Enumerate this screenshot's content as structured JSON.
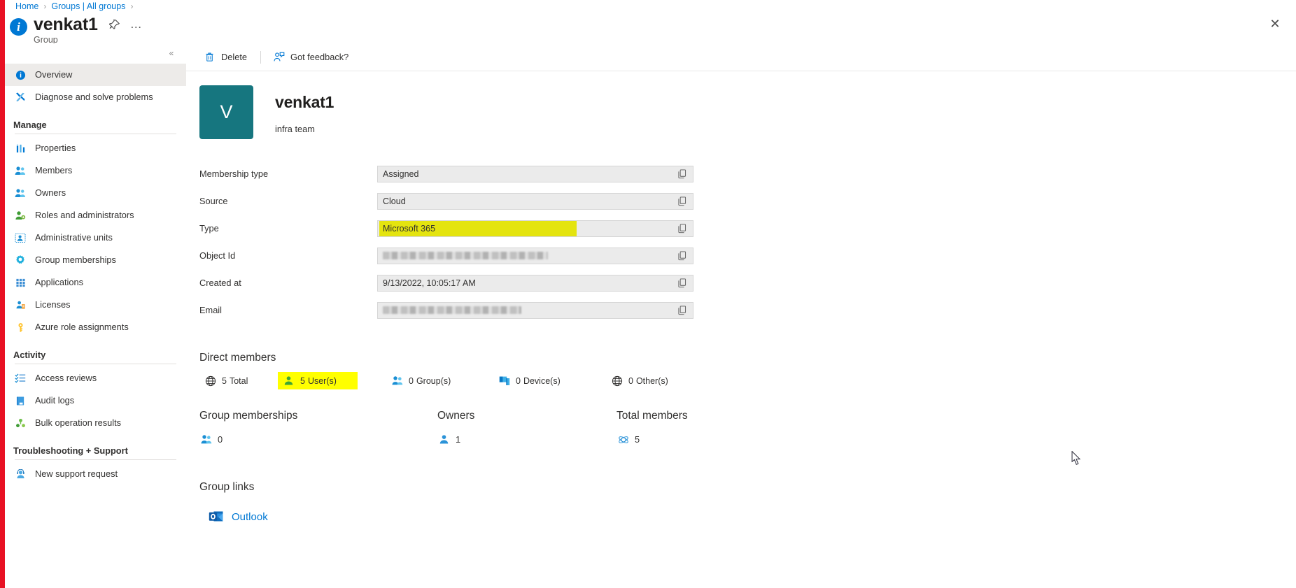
{
  "breadcrumb": {
    "items": [
      "Home",
      "Groups | All groups"
    ],
    "separator": "›"
  },
  "blade": {
    "title": "venkat1",
    "subtitle": "Group",
    "pin_label": "Pin to dashboard",
    "more_label": "…",
    "close_label": "✕",
    "collapse_label": "«"
  },
  "sidebar": {
    "items": [
      {
        "label": "Overview",
        "icon": "info-icon",
        "selected": true
      },
      {
        "label": "Diagnose and solve problems",
        "icon": "wrench-icon",
        "selected": false
      }
    ],
    "groups": [
      {
        "heading": "Manage",
        "items": [
          {
            "label": "Properties",
            "icon": "properties-icon"
          },
          {
            "label": "Members",
            "icon": "members-icon"
          },
          {
            "label": "Owners",
            "icon": "owners-icon"
          },
          {
            "label": "Roles and administrators",
            "icon": "roles-icon"
          },
          {
            "label": "Administrative units",
            "icon": "administrative-units-icon"
          },
          {
            "label": "Group memberships",
            "icon": "group-memberships-icon"
          },
          {
            "label": "Applications",
            "icon": "applications-icon"
          },
          {
            "label": "Licenses",
            "icon": "licenses-icon"
          },
          {
            "label": "Azure role assignments",
            "icon": "key-icon"
          }
        ]
      },
      {
        "heading": "Activity",
        "items": [
          {
            "label": "Access reviews",
            "icon": "access-reviews-icon"
          },
          {
            "label": "Audit logs",
            "icon": "audit-logs-icon"
          },
          {
            "label": "Bulk operation results",
            "icon": "bulk-operation-icon"
          }
        ]
      },
      {
        "heading": "Troubleshooting + Support",
        "items": [
          {
            "label": "New support request",
            "icon": "support-icon"
          }
        ]
      }
    ]
  },
  "commandbar": {
    "delete_label": "Delete",
    "feedback_label": "Got feedback?"
  },
  "identity": {
    "avatar_initial": "V",
    "avatar_color": "#16767f",
    "name": "venkat1",
    "description": "infra team"
  },
  "properties": [
    {
      "label": "Membership type",
      "value": "Assigned",
      "highlight": false,
      "redacted": false
    },
    {
      "label": "Source",
      "value": "Cloud",
      "highlight": false,
      "redacted": false
    },
    {
      "label": "Type",
      "value": "Microsoft 365",
      "highlight": true,
      "redacted": false
    },
    {
      "label": "Object Id",
      "value": "",
      "highlight": false,
      "redacted": true
    },
    {
      "label": "Created at",
      "value": "9/13/2022, 10:05:17 AM",
      "highlight": false,
      "redacted": false
    },
    {
      "label": "Email",
      "value": "",
      "highlight": false,
      "redacted": true
    }
  ],
  "direct_members": {
    "title": "Direct members",
    "stats": [
      {
        "count": "5",
        "label": "Total",
        "icon": "globe-icon",
        "highlight": false
      },
      {
        "count": "5",
        "label": "User(s)",
        "icon": "user-icon",
        "highlight": true
      },
      {
        "count": "0",
        "label": "Group(s)",
        "icon": "group-icon",
        "highlight": false
      },
      {
        "count": "0",
        "label": "Device(s)",
        "icon": "device-icon",
        "highlight": false
      },
      {
        "count": "0",
        "label": "Other(s)",
        "icon": "globe-icon",
        "highlight": false
      }
    ]
  },
  "summary": [
    {
      "title": "Group memberships",
      "value": "0",
      "icon": "group-icon"
    },
    {
      "title": "Owners",
      "value": "1",
      "icon": "owner-icon"
    },
    {
      "title": "Total members",
      "value": "5",
      "icon": "total-members-icon"
    }
  ],
  "group_links": {
    "title": "Group links",
    "links": [
      {
        "label": "Outlook",
        "icon": "outlook-icon"
      }
    ]
  },
  "colors": {
    "accent": "#0078d4",
    "rail_red": "#e81123",
    "highlight_olive": "#e4e40f",
    "highlight_yellow": "#ffff00",
    "avatar_teal": "#16767f"
  }
}
